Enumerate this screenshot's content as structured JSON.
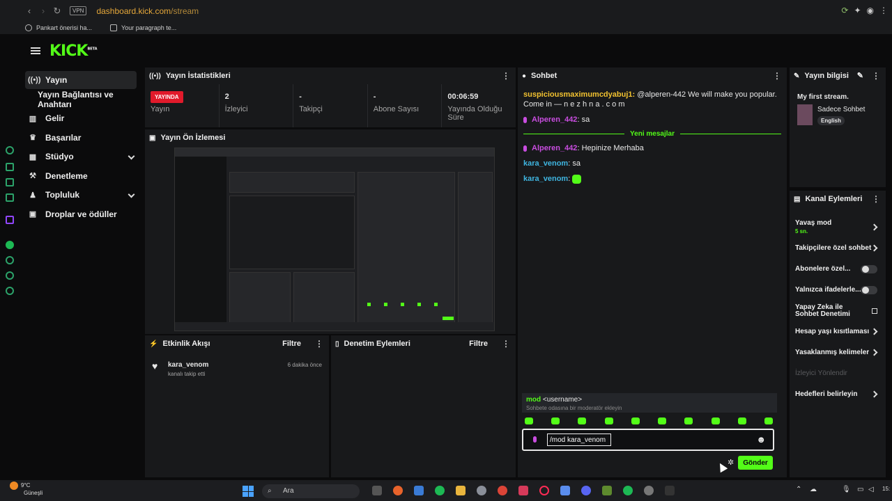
{
  "browser": {
    "url_host": "dashboard.kick.com",
    "url_path": "/stream",
    "vpn": "VPN",
    "bookmarks": [
      "Pankart önerisi ha...",
      "Your paragraph te..."
    ]
  },
  "sidebar": {
    "items": [
      {
        "label": "Yayın",
        "icon": "live-icon"
      },
      {
        "label": "Yayın Bağlantısı ve Anahtarı",
        "icon": ""
      },
      {
        "label": "Gelir",
        "icon": "chart-icon"
      },
      {
        "label": "Başarılar",
        "icon": "trophy-icon"
      },
      {
        "label": "Stüdyo",
        "icon": "grid-icon"
      },
      {
        "label": "Denetleme",
        "icon": "hammer-icon"
      },
      {
        "label": "Topluluk",
        "icon": "people-icon"
      },
      {
        "label": "Droplar ve ödüller",
        "icon": "gift-icon"
      }
    ]
  },
  "stats_panel": {
    "title": "Yayın İstatistikleri",
    "live_badge": "YAYINDA",
    "live_label": "Yayın",
    "viewers_value": "2",
    "viewers_label": "İzleyici",
    "followers_value": "-",
    "followers_label": "Takipçi",
    "subs_value": "-",
    "subs_label": "Abone Sayısı",
    "duration_value": "00:06:59",
    "duration_label": "Yayında Olduğu Süre"
  },
  "preview_panel": {
    "title": "Yayın Ön İzlemesi"
  },
  "activity_panel": {
    "title": "Etkinlik Akışı",
    "filter": "Filtre",
    "events": [
      {
        "user": "kara_venom",
        "action": "kanalı takip etti",
        "time": "6 dakika önce"
      }
    ]
  },
  "moderation_panel": {
    "title": "Denetim Eylemleri",
    "filter": "Filtre"
  },
  "chat": {
    "title": "Sohbet",
    "messages": [
      {
        "user": "suspiciousmaximumcdyabuj1",
        "text": "@alperen-442 We will make you popular. Come in — n e z h n a . c o m"
      },
      {
        "user": "Alperen_442",
        "text": "sa"
      }
    ],
    "new_messages_label": "Yeni mesajlar",
    "new_messages": [
      {
        "user": "Alperen_442",
        "text": "Hepinize Merhaba"
      },
      {
        "user": "kara_venom",
        "text": "sa"
      },
      {
        "user": "kara_venom",
        "text": ""
      }
    ],
    "suggestion_cmd": "mod",
    "suggestion_arg": "<username>",
    "suggestion_desc": "Sohbete odasına bir moderatör ekleyin",
    "input_value": "/mod kara_venom",
    "send_label": "Gönder"
  },
  "stream_info": {
    "title": "Yayın bilgisi",
    "stream_title": "My first stream.",
    "category": "Sadece Sohbet",
    "language": "English"
  },
  "channel_actions": {
    "title": "Kanal Eylemleri",
    "slow_mode": "Yavaş mod",
    "slow_mode_value": "5 sn.",
    "followers_only": "Takipçilere özel sohbet",
    "subs_only": "Abonelere özel...",
    "emotes_only": "Yalnızca ifadelerle...",
    "ai_moderation": "Yapay Zeka ile Sohbet Denetimi",
    "age_restrictions": "Hesap yaşı kısıtlaması",
    "banned_words": "Yasaklanmış kelimeler",
    "redirect_viewers": "İzleyici Yönlendir",
    "set_goals": "Hedefleri belirleyin"
  },
  "taskbar": {
    "temperature": "9°C",
    "weather": "Güneşli",
    "search": "Ara",
    "clock": "15:"
  },
  "colors": {
    "accent": "#53fc18",
    "live": "#e11a2b",
    "panel": "#18191b",
    "bg": "#0b0b0c"
  }
}
